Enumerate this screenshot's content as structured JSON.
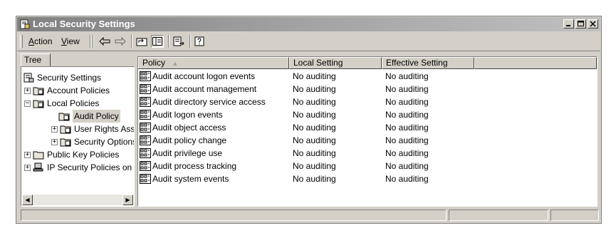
{
  "window": {
    "title": "Local Security Settings",
    "controls": [
      "minimize",
      "maximize",
      "close"
    ]
  },
  "menu": {
    "action_label": "Action",
    "action_mnemonic": "A",
    "action_rest": "ction",
    "view_label": "View",
    "view_mnemonic": "V",
    "view_rest": "iew"
  },
  "toolbar": {
    "icons": [
      "back-arrow-icon",
      "forward-arrow-icon",
      "up-one-level-icon",
      "show-hide-tree-icon",
      "export-list-icon",
      "help-icon"
    ]
  },
  "tree": {
    "tab_label": "Tree",
    "items": [
      {
        "label": "Security Settings",
        "level": 0,
        "expander": ""
      },
      {
        "label": "Account Policies",
        "level": 1,
        "expander": "+"
      },
      {
        "label": "Local Policies",
        "level": 1,
        "expander": "−"
      },
      {
        "label": "Audit Policy",
        "level": 2,
        "expander": "",
        "selected": true
      },
      {
        "label": "User Rights Assignment",
        "level": 2,
        "expander": "+"
      },
      {
        "label": "Security Options",
        "level": 2,
        "expander": "+"
      },
      {
        "label": "Public Key Policies",
        "level": 1,
        "expander": "+"
      },
      {
        "label": "IP Security Policies on Local Machine",
        "level": 1,
        "expander": "+"
      }
    ]
  },
  "list": {
    "columns": {
      "policy": "Policy",
      "local": "Local Setting",
      "effective": "Effective Setting"
    },
    "rows": [
      {
        "policy": "Audit account logon events",
        "local": "No auditing",
        "effective": "No auditing"
      },
      {
        "policy": "Audit account management",
        "local": "No auditing",
        "effective": "No auditing"
      },
      {
        "policy": "Audit directory service access",
        "local": "No auditing",
        "effective": "No auditing"
      },
      {
        "policy": "Audit logon events",
        "local": "No auditing",
        "effective": "No auditing"
      },
      {
        "policy": "Audit object access",
        "local": "No auditing",
        "effective": "No auditing"
      },
      {
        "policy": "Audit policy change",
        "local": "No auditing",
        "effective": "No auditing"
      },
      {
        "policy": "Audit privilege use",
        "local": "No auditing",
        "effective": "No auditing"
      },
      {
        "policy": "Audit process tracking",
        "local": "No auditing",
        "effective": "No auditing"
      },
      {
        "policy": "Audit system events",
        "local": "No auditing",
        "effective": "No auditing"
      }
    ]
  },
  "colors": {
    "face": "#d4d0c8",
    "shadow": "#808080",
    "title_gradient_start": "#808080"
  }
}
